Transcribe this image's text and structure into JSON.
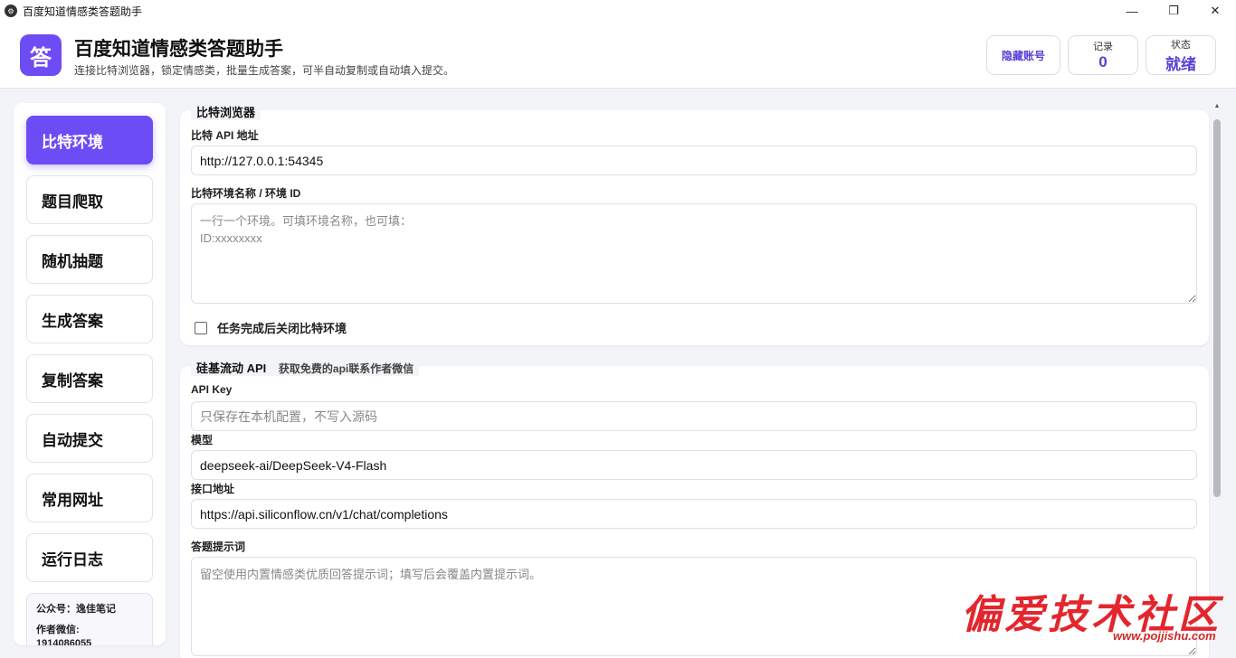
{
  "window": {
    "title": "百度知道情感类答题助手",
    "controls": {
      "minimize": "—",
      "maximize": "❐",
      "close": "✕"
    }
  },
  "header": {
    "logo_char": "答",
    "title": "百度知道情感类答题助手",
    "subtitle": "连接比特浏览器，锁定情感类，批量生成答案，可半自动复制或自动填入提交。",
    "hide_account_label": "隐藏账号",
    "record_label": "记录",
    "record_value": "0",
    "status_label": "状态",
    "status_value": "就绪",
    "accent_color": "#6c4cf4"
  },
  "sidebar": {
    "items": [
      {
        "label": "比特环境",
        "active": true
      },
      {
        "label": "题目爬取"
      },
      {
        "label": "随机抽题"
      },
      {
        "label": "生成答案"
      },
      {
        "label": "复制答案"
      },
      {
        "label": "自动提交"
      },
      {
        "label": "常用网址"
      },
      {
        "label": "运行日志"
      }
    ],
    "info": {
      "public_account": "公众号：逸佳笔记",
      "author_wechat_label": "作者微信:",
      "author_wechat": "1914086055"
    }
  },
  "bit_browser": {
    "legend": "比特浏览器",
    "api_label": "比特 API 地址",
    "api_value": "http://127.0.0.1:54345",
    "env_label": "比特环境名称 / 环境 ID",
    "env_placeholder": "一行一个环境。可填环境名称，也可填：\nID:xxxxxxxx",
    "close_env_label": "任务完成后关闭比特环境"
  },
  "silicon_api": {
    "legend": "硅基流动 API",
    "hint": "获取免费的api联系作者微信",
    "key_label": "API Key",
    "key_placeholder": "只保存在本机配置，不写入源码",
    "model_label": "模型",
    "model_value": "deepseek-ai/DeepSeek-V4-Flash",
    "endpoint_label": "接口地址",
    "endpoint_value": "https://api.siliconflow.cn/v1/chat/completions",
    "prompt_label": "答题提示词",
    "prompt_placeholder": "留空使用内置情感类优质回答提示词；填写后会覆盖内置提示词。"
  },
  "watermark": {
    "text": "偏爱技术社区",
    "url": "www.pojjishu.com"
  }
}
